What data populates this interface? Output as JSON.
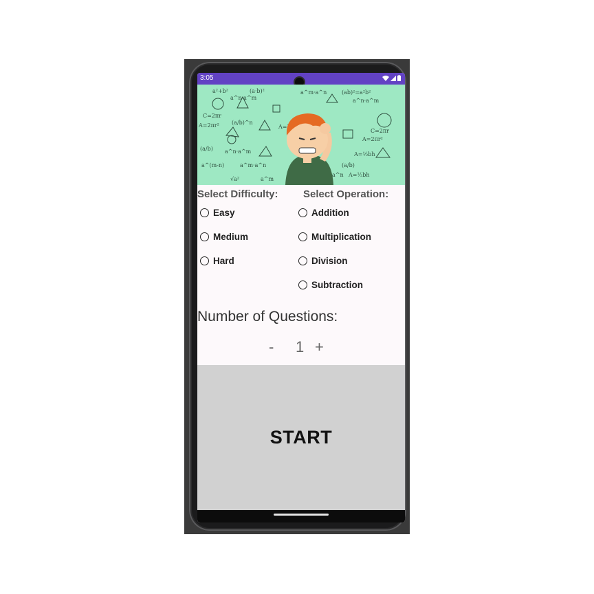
{
  "status_bar": {
    "time": "3:05",
    "icons": [
      "wifi-icon",
      "signal-icon",
      "battery-icon"
    ],
    "color": "#6242c4"
  },
  "banner": {
    "description_icon": "math-boy-illustration",
    "background": "#9ee8c3"
  },
  "difficulty": {
    "label": "Select Difficulty:",
    "options": [
      "Easy",
      "Medium",
      "Hard"
    ]
  },
  "operation": {
    "label": "Select Operation:",
    "options": [
      "Addition",
      "Multiplication",
      "Division",
      "Subtraction"
    ]
  },
  "questions": {
    "label": "Number of Questions:",
    "minus": "-",
    "count": "1",
    "plus": "+"
  },
  "start_button": {
    "label": "START",
    "background": "#d1d1d1"
  }
}
